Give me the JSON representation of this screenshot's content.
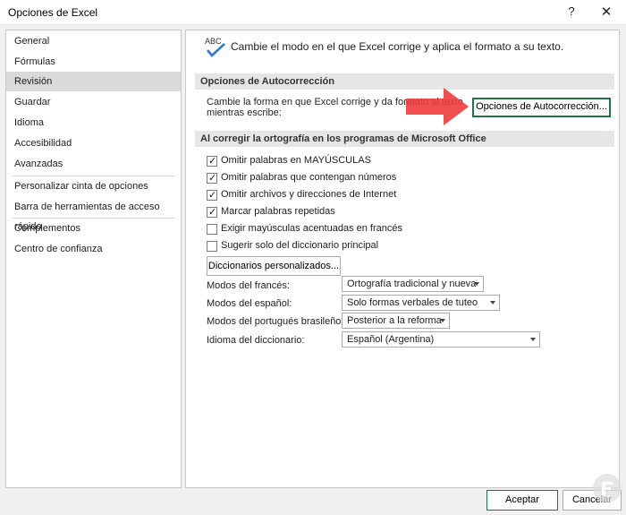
{
  "window": {
    "title": "Opciones de Excel",
    "help_glyph": "?",
    "close_glyph": "✕"
  },
  "sidebar": {
    "items": [
      {
        "label": "General"
      },
      {
        "label": "Fórmulas"
      },
      {
        "label": "Revisión",
        "selected": true
      },
      {
        "label": "Guardar"
      },
      {
        "label": "Idioma"
      },
      {
        "label": "Accesibilidad"
      },
      {
        "label": "Avanzadas"
      },
      {
        "label": "Personalizar cinta de opciones"
      },
      {
        "label": "Barra de herramientas de acceso rápido"
      },
      {
        "label": "Complementos"
      },
      {
        "label": "Centro de confianza"
      }
    ]
  },
  "main": {
    "intro_icon_text": "ABC",
    "intro": "Cambie el modo en el que Excel corrige y aplica el formato a su texto.",
    "autocorrect": {
      "header": "Opciones de Autocorrección",
      "description": "Cambie la forma en que Excel corrige y da formato al texto mientras escribe:",
      "button": "Opciones de Autocorrección..."
    },
    "spelling": {
      "header": "Al corregir la ortografía en los programas de Microsoft Office",
      "options": [
        {
          "label": "Omitir palabras en MAYÚSCULAS",
          "checked": true
        },
        {
          "label": "Omitir palabras que contengan números",
          "checked": true
        },
        {
          "label": "Omitir archivos y direcciones de Internet",
          "checked": true
        },
        {
          "label": "Marcar palabras repetidas",
          "checked": true
        },
        {
          "label": "Exigir mayúsculas acentuadas en francés",
          "checked": false
        },
        {
          "label": "Sugerir solo del diccionario principal",
          "checked": false
        }
      ],
      "dictionaries_button": "Diccionarios personalizados...",
      "modes": [
        {
          "label": "Modos del francés:",
          "value": "Ortografía tradicional y nueva"
        },
        {
          "label": "Modos del español:",
          "value": "Solo formas verbales de tuteo"
        },
        {
          "label": "Modos del portugués brasileño:",
          "value": "Posterior a la reforma"
        },
        {
          "label": "Idioma del diccionario:",
          "value": "Español (Argentina)"
        }
      ]
    }
  },
  "footer": {
    "accept": "Aceptar",
    "cancel": "Cancelar"
  },
  "colors": {
    "accent_green": "#217346",
    "arrow_red": "#f03c3c",
    "selected_nav": "#d9d9d9"
  }
}
